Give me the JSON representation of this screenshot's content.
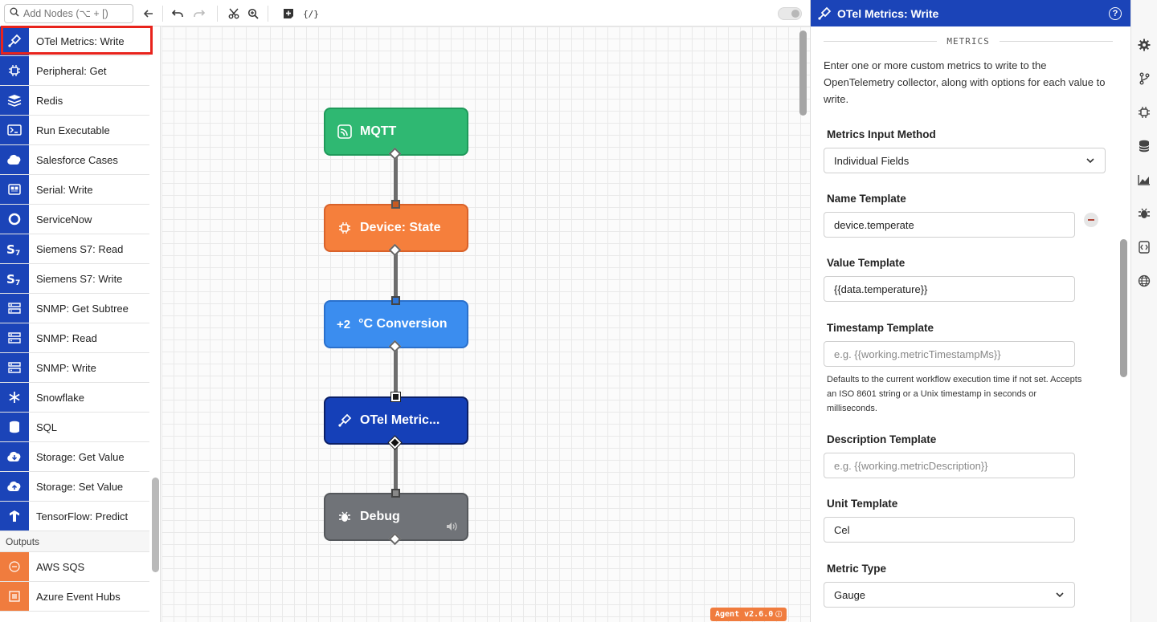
{
  "toolbar": {
    "search_placeholder": "Add Nodes (⌥ + [)",
    "icons": [
      "search-icon",
      "collapse-arrow-icon",
      "undo-icon",
      "redo-icon",
      "cut-icon",
      "zoom-icon",
      "add-note-icon",
      "json-icon"
    ]
  },
  "sidebar": {
    "items": [
      {
        "label": "OTel Metrics: Write",
        "icon": "otel-icon"
      },
      {
        "label": "Peripheral: Get",
        "icon": "chip-icon"
      },
      {
        "label": "Redis",
        "icon": "redis-icon"
      },
      {
        "label": "Run Executable",
        "icon": "terminal-icon"
      },
      {
        "label": "Salesforce Cases",
        "icon": "salesforce-icon"
      },
      {
        "label": "Serial: Write",
        "icon": "serial-icon"
      },
      {
        "label": "ServiceNow",
        "icon": "servicenow-icon"
      },
      {
        "label": "Siemens S7: Read",
        "icon": "siemens-icon"
      },
      {
        "label": "Siemens S7: Write",
        "icon": "siemens-icon"
      },
      {
        "label": "SNMP: Get Subtree",
        "icon": "snmp-icon"
      },
      {
        "label": "SNMP: Read",
        "icon": "snmp-icon"
      },
      {
        "label": "SNMP: Write",
        "icon": "snmp-icon"
      },
      {
        "label": "Snowflake",
        "icon": "snowflake-icon"
      },
      {
        "label": "SQL",
        "icon": "database-icon"
      },
      {
        "label": "Storage: Get Value",
        "icon": "cloud-download-icon"
      },
      {
        "label": "Storage: Set Value",
        "icon": "cloud-upload-icon"
      },
      {
        "label": "TensorFlow: Predict",
        "icon": "tensorflow-icon"
      }
    ],
    "outputs_header": "Outputs",
    "outputs": [
      {
        "label": "AWS SQS",
        "icon": "aws-sqs-icon"
      },
      {
        "label": "Azure Event Hubs",
        "icon": "azure-icon"
      }
    ]
  },
  "canvas": {
    "nodes": [
      {
        "label": "MQTT",
        "color": "#2fb872",
        "border": "#1f9a5a",
        "icon": "mqtt-icon"
      },
      {
        "label": "Device: State",
        "color": "#f57f3c",
        "border": "#d9622a",
        "icon": "chip-icon"
      },
      {
        "label": "°C Conversion",
        "prefix": "+2",
        "color": "#3b8def",
        "border": "#2a70cc",
        "icon": "math-icon"
      },
      {
        "label": "OTel Metric...",
        "color": "#1540b8",
        "border": "#0b1f66",
        "icon": "otel-icon"
      },
      {
        "label": "Debug",
        "color": "#707378",
        "border": "#55585c",
        "icon": "bug-icon"
      }
    ],
    "agent_badge": "Agent v2.6.0"
  },
  "panel": {
    "title": "OTel Metrics: Write",
    "section": "METRICS",
    "description": "Enter one or more custom metrics to write to the OpenTelemetry collector, along with options for each value to write.",
    "input_method_label": "Metrics Input Method",
    "input_method_value": "Individual Fields",
    "name_template_label": "Name Template",
    "name_template_value": "device.temperate",
    "value_template_label": "Value Template",
    "value_template_value": "{{data.temperature}}",
    "timestamp_template_label": "Timestamp Template",
    "timestamp_template_placeholder": "e.g. {{working.metricTimestampMs}}",
    "timestamp_help": "Defaults to the current workflow execution time if not set. Accepts an ISO 8601 string or a Unix timestamp in seconds or milliseconds.",
    "description_template_label": "Description Template",
    "description_template_placeholder": "e.g. {{working.metricDescription}}",
    "unit_template_label": "Unit Template",
    "unit_template_value": "Cel",
    "metric_type_label": "Metric Type",
    "metric_type_value": "Gauge"
  },
  "rail": {
    "icons": [
      "settings-icon",
      "branch-icon",
      "chip-icon",
      "database-icon",
      "chart-icon",
      "bug-icon",
      "code-icon",
      "globe-icon"
    ]
  }
}
